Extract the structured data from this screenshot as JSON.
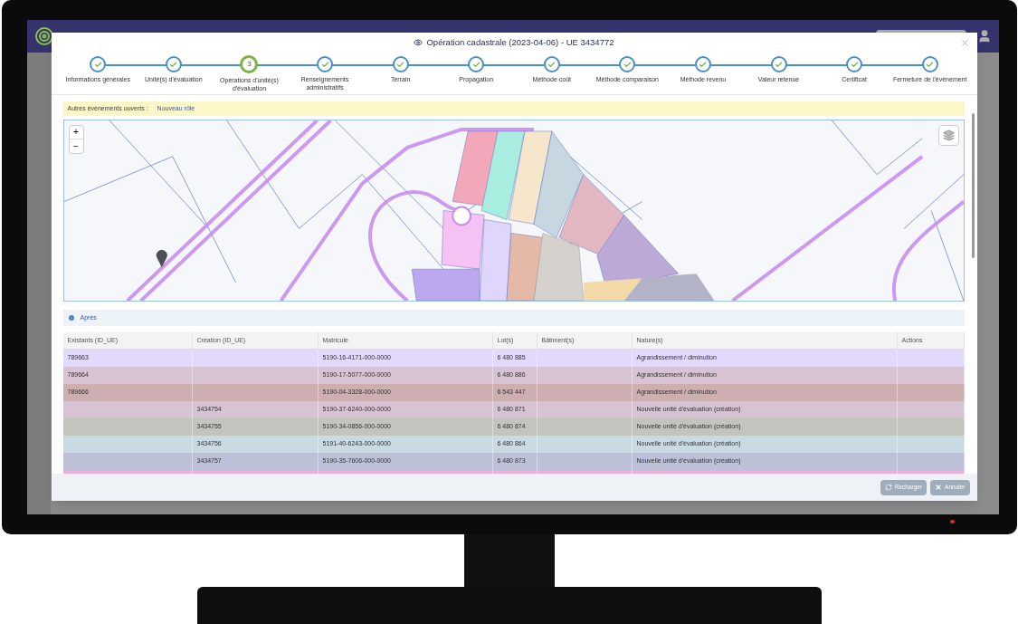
{
  "modal": {
    "title": "Opération cadastrale (2023-04-06) - UE 3434772",
    "steps": [
      {
        "label": "Informations générales",
        "completed": true,
        "selected": false
      },
      {
        "label": "Unité(s) d'évaluation",
        "completed": true,
        "selected": false
      },
      {
        "label": "Opérations d'unité(s) d'évaluation",
        "completed": false,
        "selected": true,
        "number": "3"
      },
      {
        "label": "Renseignements administratifs",
        "completed": true,
        "selected": false
      },
      {
        "label": "Terrain",
        "completed": true,
        "selected": false
      },
      {
        "label": "Propagation",
        "completed": true,
        "selected": false
      },
      {
        "label": "Méthode coût",
        "completed": true,
        "selected": false
      },
      {
        "label": "Méthode comparaison",
        "completed": true,
        "selected": false
      },
      {
        "label": "Méthode revenu",
        "completed": true,
        "selected": false
      },
      {
        "label": "Valeur retenue",
        "completed": true,
        "selected": false
      },
      {
        "label": "Certificat",
        "completed": true,
        "selected": false
      },
      {
        "label": "Fermeture de l'événement",
        "completed": true,
        "selected": false
      }
    ],
    "alert": {
      "label": "Autres évènements ouverts :",
      "link": "Nouveau rôle"
    },
    "map": {
      "zoom_in": "+",
      "zoom_out": "−"
    },
    "section": {
      "title": "Après",
      "expanded": false
    },
    "table": {
      "columns": [
        "Existants (ID_UE)",
        "Création (ID_UE)",
        "Matricule",
        "Lot(s)",
        "Bâtiment(s)",
        "Nature(s)",
        "Actions"
      ],
      "rows": [
        {
          "color": "#e3d9fd",
          "cells": [
            "789663",
            "",
            "5190-16-4171-000-0000",
            "6 480 885",
            "",
            "Agrandissement / diminution",
            ""
          ]
        },
        {
          "color": "#d7c3d3",
          "cells": [
            "789664",
            "",
            "5190-17-5077-000-0000",
            "6 480 886",
            "",
            "Agrandissement / diminution",
            ""
          ]
        },
        {
          "color": "#cdafaf",
          "cells": [
            "789666",
            "",
            "5190-04-3328-000-0000",
            "6 543 447",
            "",
            "Agrandissement / diminution",
            ""
          ]
        },
        {
          "color": "#d6c4d5",
          "cells": [
            "",
            "3434754",
            "5190-37-6240-000-0000",
            "6 480 871",
            "",
            "Nouvelle unité d'évaluation (création)",
            ""
          ]
        },
        {
          "color": "#c1c5bd",
          "cells": [
            "",
            "3434755",
            "5190-34-0856-000-0000",
            "6 480 874",
            "",
            "Nouvelle unité d'évaluation (création)",
            ""
          ]
        },
        {
          "color": "#c9dae2",
          "cells": [
            "",
            "3434756",
            "5191-40-6243-000-0000",
            "6 480 864",
            "",
            "Nouvelle unité d'évaluation (création)",
            ""
          ]
        },
        {
          "color": "#bdc1d8",
          "cells": [
            "",
            "3434757",
            "5190-35-7606-000-0000",
            "6 480 873",
            "",
            "Nouvelle unité d'évaluation (création)",
            ""
          ]
        },
        {
          "color": "#ebb0d8",
          "cells": [
            "",
            "",
            "",
            "",
            "",
            "",
            ""
          ]
        }
      ]
    },
    "buttons": [
      {
        "label": "Recharger",
        "kind": "reload"
      },
      {
        "label": "Annuler",
        "kind": "cancel"
      }
    ]
  }
}
